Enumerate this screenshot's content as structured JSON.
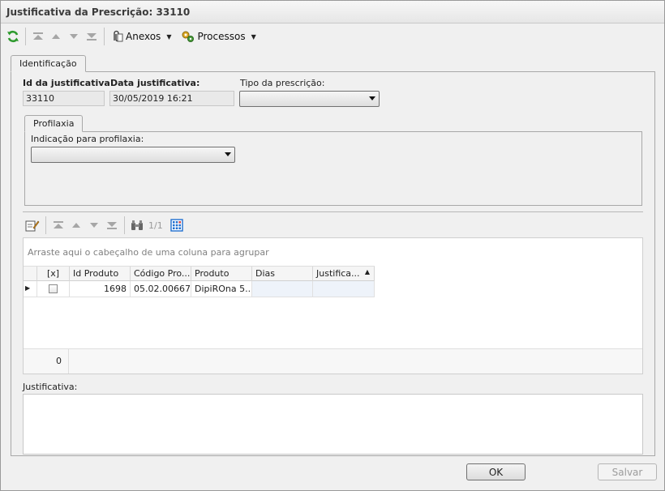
{
  "window": {
    "title": "Justificativa da Prescrição: 33110"
  },
  "toolbar": {
    "anexos_label": "Anexos",
    "processos_label": "Processos"
  },
  "tabs": {
    "identificacao": "Identificação",
    "profilaxia": "Profilaxia"
  },
  "fields": {
    "id_label": "Id da justificativa:",
    "id_value": "33110",
    "data_label": "Data justificativa:",
    "data_value": "30/05/2019 16:21",
    "tipo_label": "Tipo da prescrição:",
    "tipo_value": "",
    "indicacao_label": "Indicação para profilaxia:",
    "indicacao_value": ""
  },
  "grid": {
    "record_counter": "1/1",
    "group_hint": "Arraste aqui o cabeçalho de uma coluna para agrupar",
    "columns": [
      "[x]",
      "Id Produto",
      "Código Pro...",
      "Produto",
      "Dias",
      "Justifica..."
    ],
    "rows": [
      {
        "checked": false,
        "id_produto": "1698",
        "codigo": "05.02.00667",
        "produto": "DipiROna 5...",
        "dias": "",
        "justificativa": ""
      }
    ],
    "footer_count": "0"
  },
  "justificativa": {
    "label": "Justificativa:",
    "value": ""
  },
  "buttons": {
    "ok": "OK",
    "salvar": "Salvar"
  },
  "colors": {
    "refresh_icon": "#2e9a2e",
    "grid_layout_icon": "#1f6fd0"
  }
}
